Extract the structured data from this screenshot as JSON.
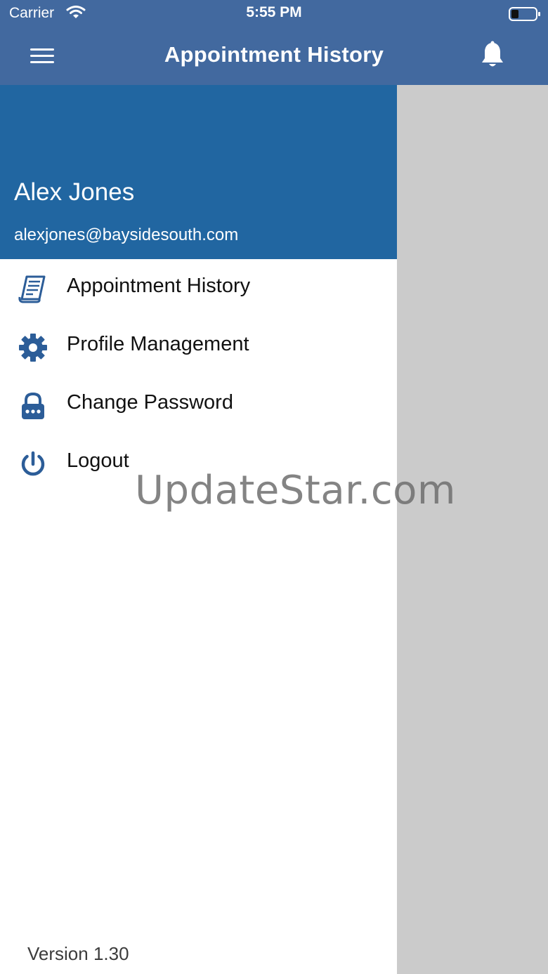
{
  "status_bar": {
    "carrier": "Carrier",
    "time": "5:55 PM",
    "wifi_icon": "wifi-icon",
    "battery_icon": "battery-icon"
  },
  "app_bar": {
    "title": "Appointment History",
    "menu_icon": "hamburger-menu-icon",
    "notification_icon": "bell-icon"
  },
  "drawer": {
    "user": {
      "name": "Alex Jones",
      "email": "alexjones@baysidesouth.com"
    },
    "items": [
      {
        "label": "Appointment History",
        "icon": "document-list-icon"
      },
      {
        "label": "Profile Management",
        "icon": "gear-icon"
      },
      {
        "label": "Change Password",
        "icon": "lock-icon"
      },
      {
        "label": "Logout",
        "icon": "power-icon"
      }
    ],
    "version": "Version 1.30"
  },
  "watermark": "UpdateStar.com",
  "colors": {
    "app_bar": "#42699f",
    "drawer_header": "#2166a1",
    "icon": "#2c5d98",
    "overlay": "#cbcbcb"
  }
}
